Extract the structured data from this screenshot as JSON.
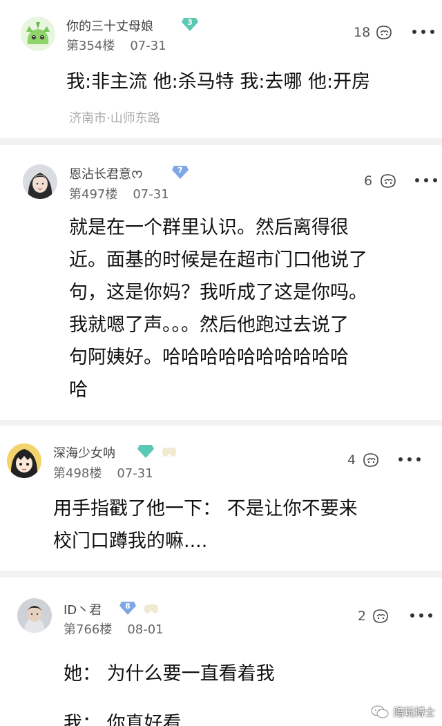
{
  "comments": [
    {
      "username": "你的三十丈母娘",
      "level": "3",
      "floor": "第354楼",
      "date": "07-31",
      "likes": "18",
      "lines": [
        "我:非主流 他:杀马特 我:去哪 他:开房"
      ],
      "location": "济南市·山师东路",
      "avatar": "green-creature-avatar"
    },
    {
      "username": "恩沾长君意ᰔ",
      "level": "7",
      "floor": "第497楼",
      "date": "07-31",
      "likes": "6",
      "lines": [
        "就是在一个群里认识。然后离得很",
        "近。面基的时候是在超市门口他说了",
        "句，这是你妈？我听成了这是你吗。",
        "我就嗯了声。。。然后他跑过去说了",
        "句阿姨好。哈哈哈哈哈哈哈哈哈哈",
        "哈"
      ],
      "avatar": "girl-photo-avatar"
    },
    {
      "username": "深海少女呐",
      "level": "",
      "floor": "第498楼",
      "date": "07-31",
      "likes": "4",
      "lines": [
        "用手指戳了他一下： 不是让你不要来",
        "校门口蹲我的嘛...."
      ],
      "avatar": "anime-girl-avatar"
    },
    {
      "username": "ID丶君",
      "level": "8",
      "floor": "第766楼",
      "date": "08-01",
      "likes": "2",
      "lines": [
        "她： 为什么要一直看着我",
        "我： 你真好看"
      ],
      "avatar": "boy-photo-avatar"
    }
  ],
  "colors": {
    "badge_teal": "#5cc9b4",
    "badge_blue": "#7ea7e6",
    "divider": "#f2f2f2"
  },
  "watermark": {
    "text": "陪玩博士",
    "icon": "wechat-official-icon"
  }
}
